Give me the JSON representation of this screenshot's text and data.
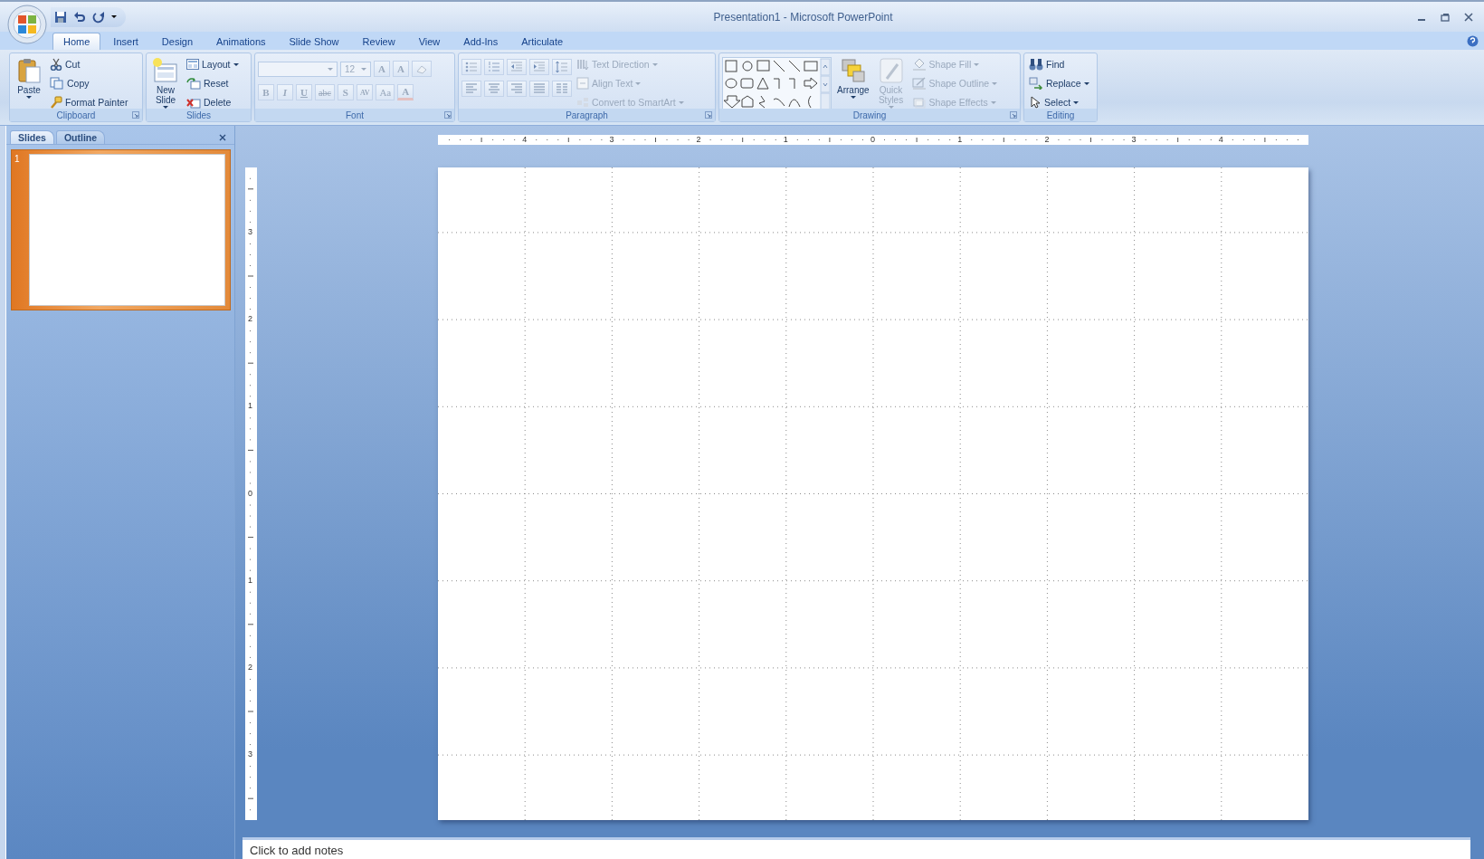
{
  "window": {
    "title": "Presentation1 - Microsoft PowerPoint"
  },
  "tabs": [
    {
      "label": "Home",
      "selected": true
    },
    {
      "label": "Insert",
      "selected": false
    },
    {
      "label": "Design",
      "selected": false
    },
    {
      "label": "Animations",
      "selected": false
    },
    {
      "label": "Slide Show",
      "selected": false
    },
    {
      "label": "Review",
      "selected": false
    },
    {
      "label": "View",
      "selected": false
    },
    {
      "label": "Add-Ins",
      "selected": false
    },
    {
      "label": "Articulate",
      "selected": false
    }
  ],
  "ribbon": {
    "groups": [
      {
        "kind": "clipboard",
        "label": "Clipboard",
        "launcher": true,
        "buttons": [
          {
            "label": "Paste",
            "dropdown": true,
            "disabled": false
          },
          {
            "label": "Cut",
            "dropdown": false,
            "disabled": false
          },
          {
            "label": "Copy",
            "dropdown": false,
            "disabled": false
          },
          {
            "label": "Format Painter",
            "dropdown": false,
            "disabled": false
          }
        ]
      },
      {
        "kind": "slides",
        "label": "Slides",
        "launcher": false,
        "buttons": [
          {
            "label": "New Slide",
            "dropdown": true,
            "disabled": false
          },
          {
            "label": "Layout",
            "dropdown": true,
            "disabled": false
          },
          {
            "label": "Reset",
            "dropdown": false,
            "disabled": false
          },
          {
            "label": "Delete",
            "dropdown": false,
            "disabled": false
          }
        ]
      },
      {
        "kind": "font",
        "label": "Font",
        "launcher": true,
        "font_size": "12",
        "size_buttons": [
          {
            "label": "A",
            "disabled": true
          },
          {
            "label": "A",
            "disabled": true
          }
        ],
        "buttons": [
          {
            "label": "B",
            "disabled": true
          },
          {
            "label": "I",
            "disabled": true
          },
          {
            "label": "U",
            "disabled": true
          },
          {
            "label": "abc",
            "disabled": true
          },
          {
            "label": "S",
            "disabled": true
          },
          {
            "label": "AV",
            "disabled": true
          },
          {
            "label": "Aa",
            "disabled": true
          },
          {
            "label": "A",
            "disabled": true
          }
        ]
      },
      {
        "kind": "paragraph",
        "label": "Paragraph",
        "launcher": true,
        "buttons": [
          {
            "label": "Text Direction",
            "dropdown": true,
            "disabled": true
          },
          {
            "label": "Align Text",
            "dropdown": true,
            "disabled": true
          },
          {
            "label": "Convert to SmartArt",
            "dropdown": true,
            "disabled": true
          }
        ]
      },
      {
        "kind": "drawing",
        "label": "Drawing",
        "launcher": true,
        "buttons": [
          {
            "label": "Arrange",
            "dropdown": true,
            "disabled": false
          },
          {
            "label": "Quick Styles",
            "dropdown": true,
            "disabled": true
          },
          {
            "label": "Shape Fill",
            "dropdown": true,
            "disabled": true
          },
          {
            "label": "Shape Outline",
            "dropdown": true,
            "disabled": true
          },
          {
            "label": "Shape Effects",
            "dropdown": true,
            "disabled": true
          }
        ]
      },
      {
        "kind": "editing",
        "label": "Editing",
        "launcher": false,
        "buttons": [
          {
            "label": "Find",
            "dropdown": false,
            "disabled": false
          },
          {
            "label": "Replace",
            "dropdown": true,
            "disabled": false
          },
          {
            "label": "Select",
            "dropdown": true,
            "disabled": false
          }
        ]
      }
    ]
  },
  "panel": {
    "tabs": [
      {
        "label": "Slides",
        "selected": true
      },
      {
        "label": "Outline",
        "selected": false
      }
    ],
    "thumbnails": [
      {
        "number": "1",
        "selected": true
      }
    ]
  },
  "horizontal_ruler": {
    "labels": [
      "4",
      "3",
      "2",
      "1",
      "0",
      "1",
      "2",
      "3",
      "4"
    ]
  },
  "vertical_ruler": {
    "labels": [
      "3",
      "2",
      "1",
      "0",
      "1",
      "2",
      "3"
    ]
  },
  "notes": {
    "prompt_text": "Click to add notes"
  }
}
